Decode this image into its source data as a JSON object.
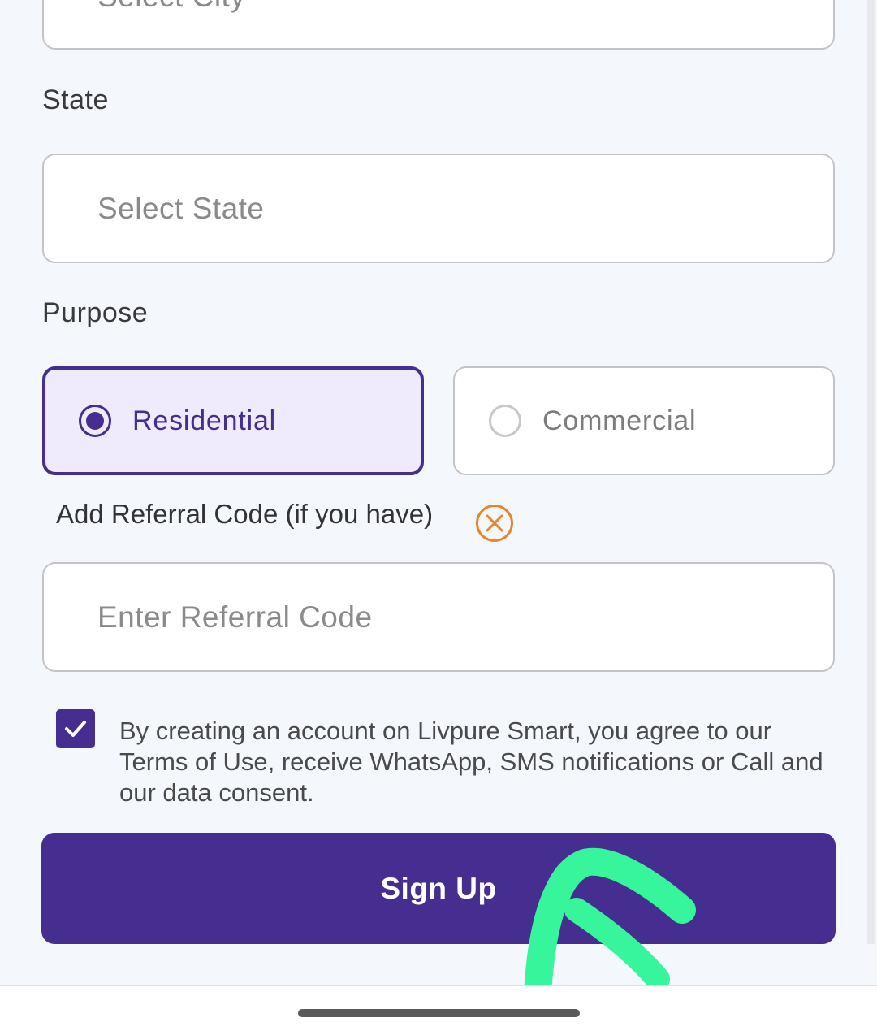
{
  "city": {
    "placeholder": "Select City"
  },
  "state": {
    "label": "State",
    "placeholder": "Select State"
  },
  "purpose": {
    "label": "Purpose",
    "options": [
      {
        "label": "Residential",
        "selected": true
      },
      {
        "label": "Commercial",
        "selected": false
      }
    ]
  },
  "referral": {
    "label": "Add Referral Code (if you have)",
    "placeholder": "Enter Referral Code",
    "close_icon": "close-circle-icon"
  },
  "consent": {
    "checked": true,
    "text": "By creating an account on Livpure Smart, you agree to our Terms of Use, receive WhatsApp, SMS notifications or Call and our data consent."
  },
  "signup": {
    "label": "Sign Up"
  },
  "colors": {
    "primary": "#452e8f",
    "selected_bg": "#efeafc",
    "close_icon": "#e8842a",
    "annotation_arrow": "#36f59a",
    "background": "#f4f7fc"
  }
}
